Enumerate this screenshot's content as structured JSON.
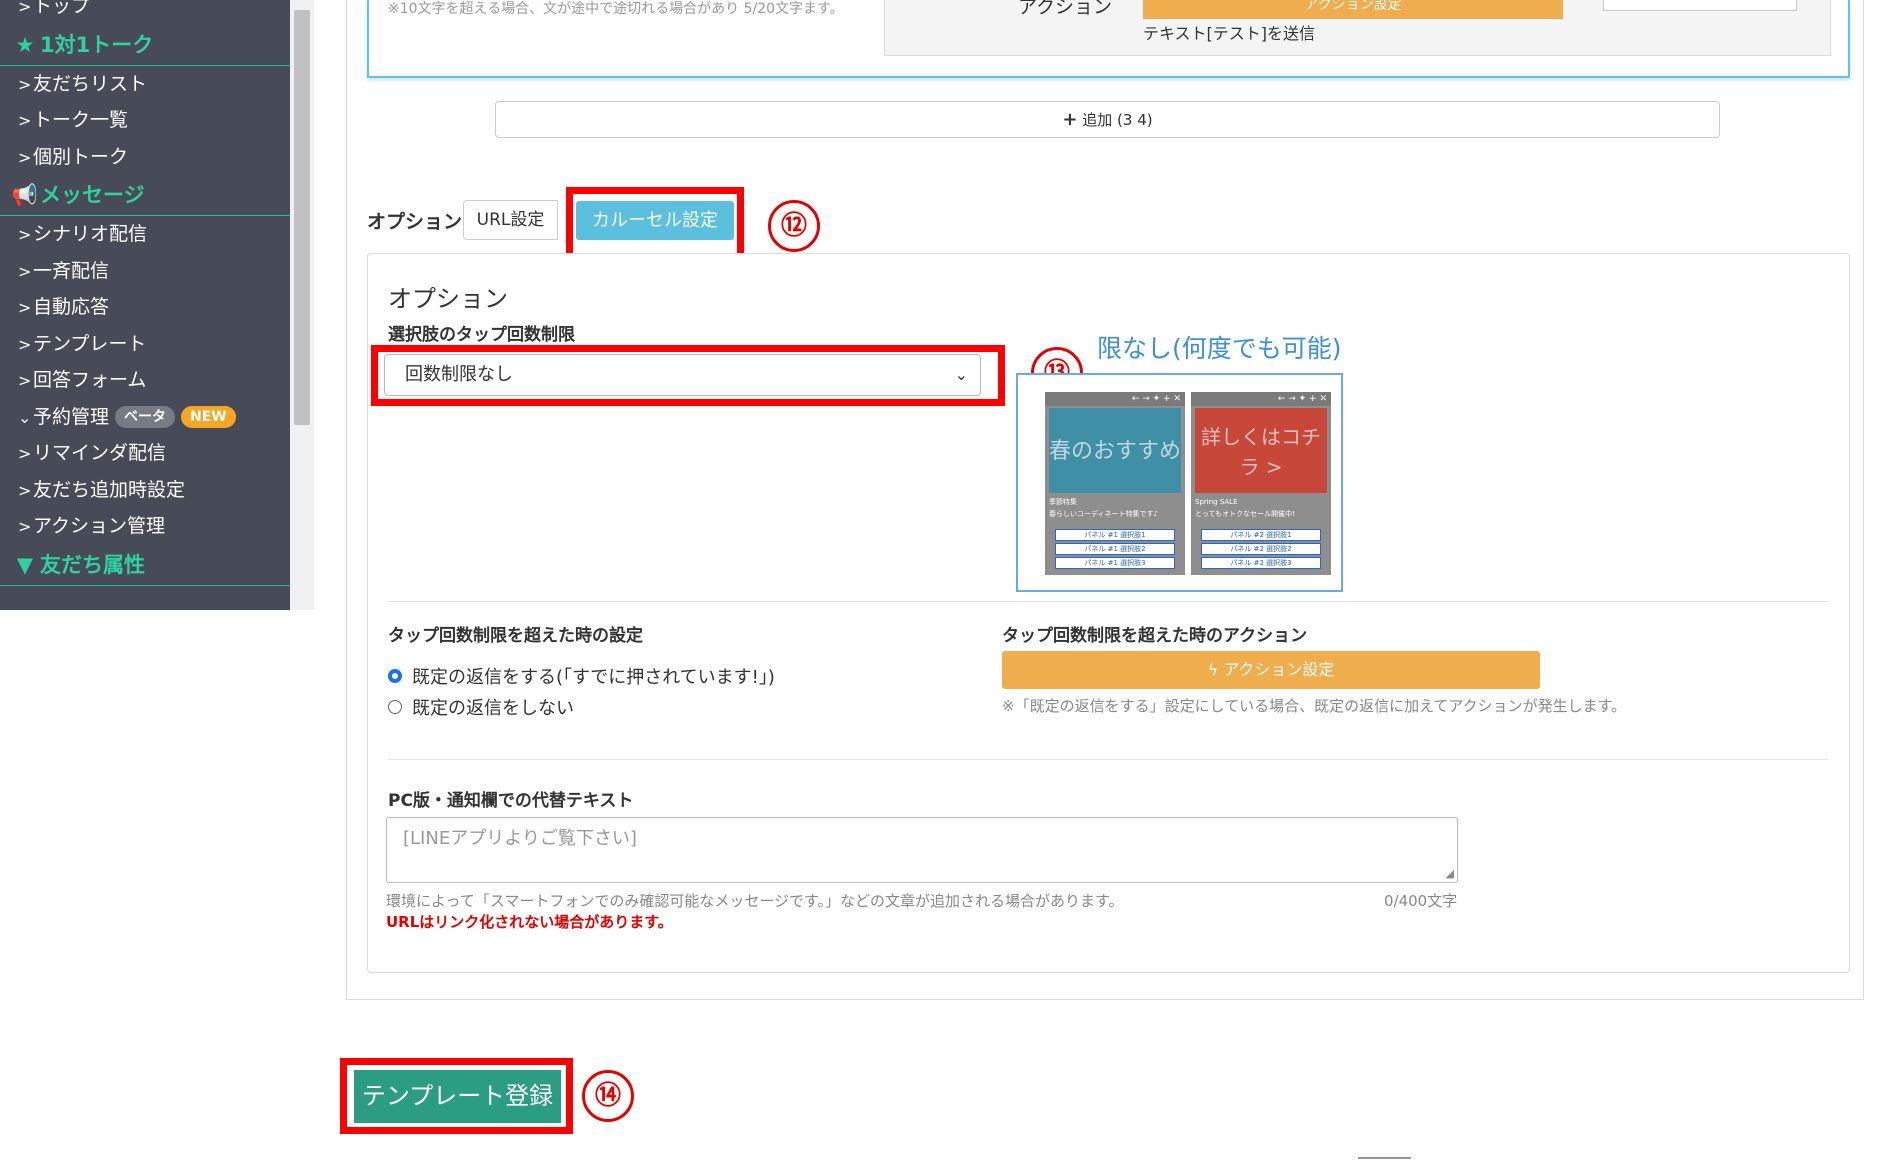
{
  "sidebar": {
    "items": [
      {
        "type": "item",
        "label": "トップ",
        "chevron": ">"
      },
      {
        "type": "section",
        "label": "1対1トーク",
        "icon": "star-icon",
        "glyph": "★"
      },
      {
        "type": "item",
        "label": "友だちリスト",
        "chevron": ">"
      },
      {
        "type": "item",
        "label": "トーク一覧",
        "chevron": ">"
      },
      {
        "type": "item",
        "label": "個別トーク",
        "chevron": ">"
      },
      {
        "type": "section",
        "label": "メッセージ",
        "icon": "megaphone-icon",
        "glyph": "📢"
      },
      {
        "type": "item",
        "label": "シナリオ配信",
        "chevron": ">"
      },
      {
        "type": "item",
        "label": "一斉配信",
        "chevron": ">"
      },
      {
        "type": "item",
        "label": "自動応答",
        "chevron": ">"
      },
      {
        "type": "item",
        "label": "テンプレート",
        "chevron": ">"
      },
      {
        "type": "item",
        "label": "回答フォーム",
        "chevron": ">"
      },
      {
        "type": "item",
        "label": "予約管理",
        "chevron": "⌄",
        "badges": [
          "ベータ",
          "NEW"
        ]
      },
      {
        "type": "item",
        "label": "リマインダ配信",
        "chevron": ">"
      },
      {
        "type": "item",
        "label": "友だち追加時設定",
        "chevron": ">"
      },
      {
        "type": "item",
        "label": "アクション管理",
        "chevron": ">"
      },
      {
        "type": "section",
        "label": "友だち属性",
        "icon": "filter-icon",
        "glyph": "▼"
      }
    ]
  },
  "top_card": {
    "note": "※10文字を超える場合、文が途中で途切れる場合があり 5/20文字ます。",
    "action_label": "アクション",
    "action_button": "アクション設定",
    "action_sub": "テキスト[テスト]を送信"
  },
  "add_button": {
    "icon": "plus-icon",
    "label": "追加 (3 4)"
  },
  "options": {
    "label": "オプション",
    "tab_url": "URL設定",
    "tab_carousel": "カルーセル設定"
  },
  "annotations": {
    "n12": "⑫",
    "n13": "⑬",
    "n14": "⑭"
  },
  "panel": {
    "title": "オプション",
    "tap_limit_label": "選択肢のタップ回数制限",
    "tap_limit_value": "回数制限なし",
    "preview_caption": "限なし(何度でも可能)",
    "preview": {
      "left_image_text": "春のおすすめ",
      "right_image_text": "詳しくはコチラ >",
      "left_title": "季節特集",
      "left_desc": "春らしいコーディネート特集です♪",
      "right_title": "Spring SALE",
      "right_desc": "とってもオトクなセール開催中!",
      "left_buttons": [
        "パネル #1 選択肢1",
        "パネル #1 選択肢2",
        "パネル #1 選択肢3"
      ],
      "right_buttons": [
        "パネル #2 選択肢1",
        "パネル #2 選択肢2",
        "パネル #2 選択肢3"
      ]
    },
    "over_limit_label": "タップ回数制限を超えた時の設定",
    "radio_reply": "既定の返信をする(「すでに押されています!」)",
    "radio_no_reply": "既定の返信をしない",
    "over_limit_action_label": "タップ回数制限を超えた時のアクション",
    "action_button": "アクション設定",
    "action_note": "※「既定の返信をする」設定にしている場合、既定の返信に加えてアクションが発生します。",
    "alt_text_label": "PC版・通知欄での代替テキスト",
    "alt_text_placeholder": "[LINEアプリよりご覧下さい]",
    "alt_note": "環境によって「スマートフォンでのみ確認可能なメッセージです。」などの文章が追加される場合があります。",
    "alt_count": "0/400文字",
    "alt_warning": "URLはリンク化されない場合があります。"
  },
  "register_button": "テンプレート登録",
  "colors": {
    "sidebar_bg": "#474b57",
    "section_text": "#2fd0a2",
    "carousel_tab": "#5bc0de",
    "action_orange": "#f0ad4e",
    "register_green": "#2a9d82",
    "annotation_red": "#ff0000"
  }
}
